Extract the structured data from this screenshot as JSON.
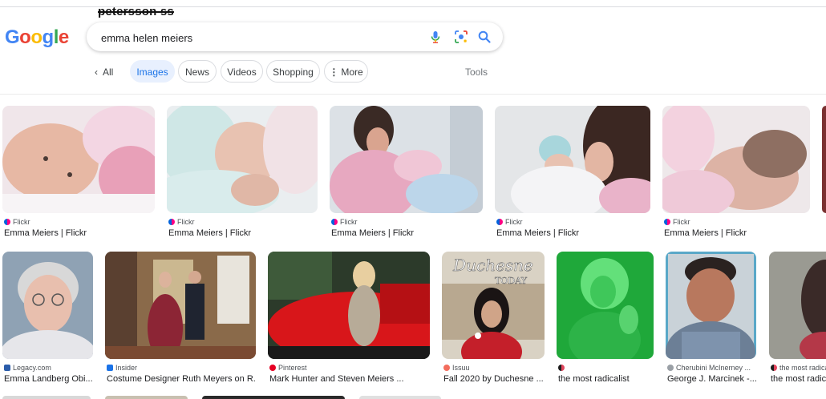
{
  "overlay_text": "petersson ss",
  "logo": [
    "G",
    "o",
    "o",
    "g",
    "l",
    "e"
  ],
  "logo_colors": [
    "#4285f4",
    "#ea4335",
    "#fbbc05",
    "#4285f4",
    "#34a853",
    "#ea4335"
  ],
  "search": {
    "value": "emma helen meiers"
  },
  "nav": {
    "all": "All",
    "tools": "Tools",
    "chips": [
      "Images",
      "News",
      "Videos",
      "Shopping",
      "More"
    ]
  },
  "row1": [
    {
      "source": "Flickr",
      "title": "Emma Meiers | Flickr"
    },
    {
      "source": "Flickr",
      "title": "Emma Meiers | Flickr"
    },
    {
      "source": "Flickr",
      "title": "Emma Meiers | Flickr"
    },
    {
      "source": "Flickr",
      "title": "Emma Meiers | Flickr"
    },
    {
      "source": "Flickr",
      "title": "Emma Meiers | Flickr"
    }
  ],
  "row2": [
    {
      "source": "Legacy.com",
      "title": "Emma Landberg Obi..."
    },
    {
      "source": "Insider",
      "title": "Costume Designer Ruth Meyers on R..."
    },
    {
      "source": "Pinterest",
      "title": "Mark Hunter and Steven Meiers ..."
    },
    {
      "source": "Issuu",
      "title": "Fall 2020 by Duchesne ..."
    },
    {
      "source": "",
      "title": "the most radicalist"
    },
    {
      "source": "Cherubini McInerney ...",
      "title": "George J. Marcinek -..."
    },
    {
      "source": "the most radicalist",
      "title": "the most radic"
    }
  ],
  "image_texts": {
    "duchesne": "Duchesne",
    "today": "TODAY"
  }
}
